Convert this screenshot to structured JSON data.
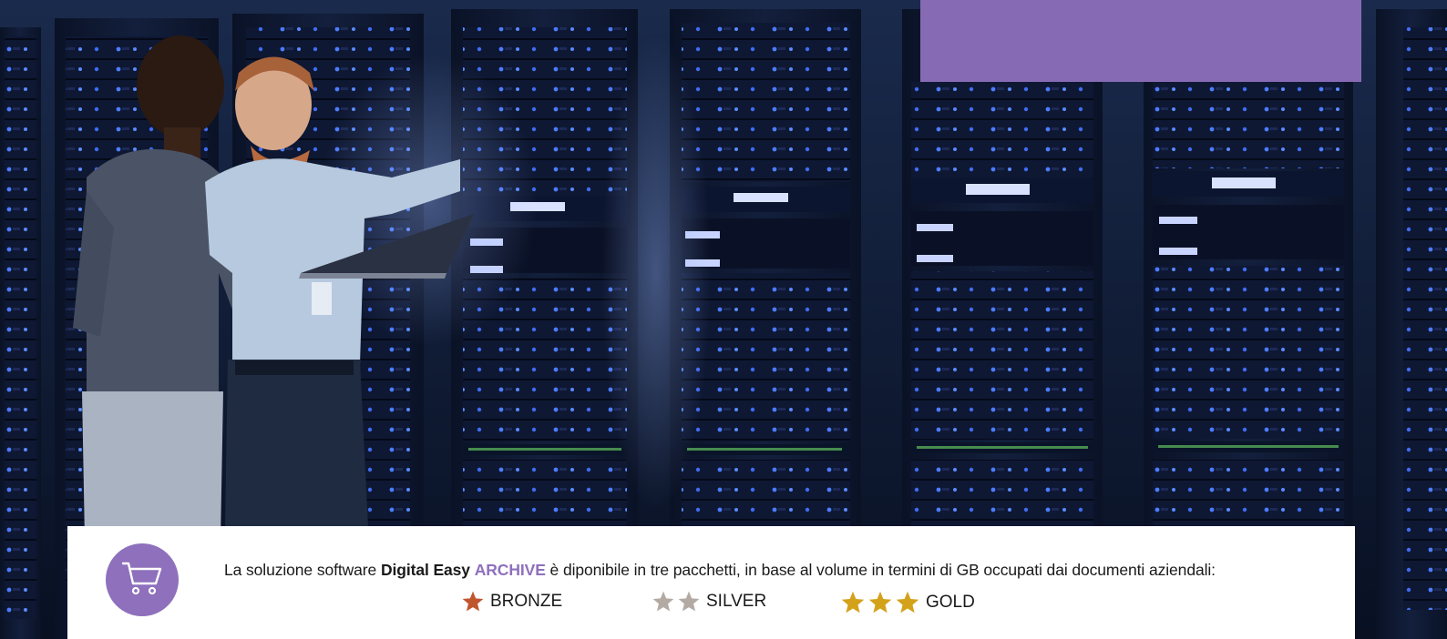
{
  "hero": {
    "image_icon": "server-room-photo"
  },
  "info": {
    "text_before": "La soluzione software ",
    "brand_primary": "Digital Easy",
    "brand_accent": "ARCHIVE",
    "text_after": " è diponibile in tre pacchetti, in base al volume in termini di GB occupati dai documenti aziendali:",
    "icon": "shopping-cart-icon"
  },
  "packages": [
    {
      "label": "BRONZE",
      "stars": 1,
      "color": "#c0562e"
    },
    {
      "label": "SILVER",
      "stars": 2,
      "color": "#b3aaa3"
    },
    {
      "label": "GOLD",
      "stars": 3,
      "color": "#d4a11a"
    }
  ],
  "colors": {
    "accent": "#8e70bc",
    "purple_block": "#866bb4",
    "panel_bg": "#ffffff"
  }
}
